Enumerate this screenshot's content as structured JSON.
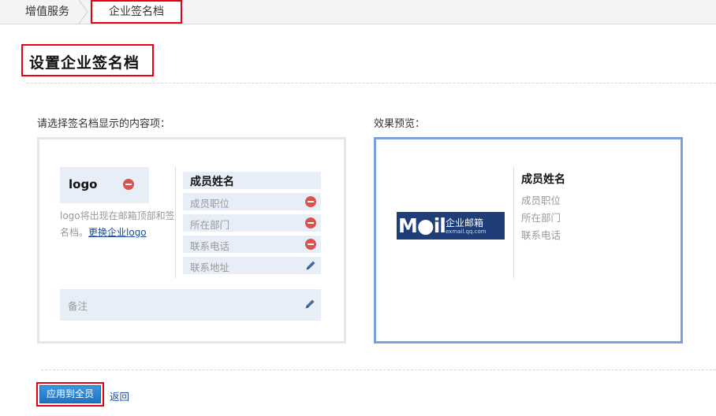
{
  "breadcrumb": {
    "items": [
      "增值服务",
      "企业签名档"
    ]
  },
  "page": {
    "title": "设置企业签名档"
  },
  "editor": {
    "section_label": "请选择签名档显示的内容项：",
    "logo": {
      "label": "logo",
      "note": "logo将出现在邮箱顶部和签名档。",
      "change_link": "更换企业logo"
    },
    "fields": [
      {
        "label": "成员姓名",
        "action": "none"
      },
      {
        "label": "成员职位",
        "action": "remove-icon"
      },
      {
        "label": "所在部门",
        "action": "remove-icon"
      },
      {
        "label": "联系电话",
        "action": "remove-icon"
      },
      {
        "label": "联系地址",
        "action": "pencil-icon"
      }
    ],
    "note_field": {
      "label": "备注",
      "action": "pencil-icon"
    }
  },
  "preview": {
    "section_label": "效果预览：",
    "logo": {
      "brand": "M●il",
      "cn_text": "企业邮箱",
      "url_text": "exmail.qq.com"
    },
    "name": "成员姓名",
    "lines": [
      "成员职位",
      "所在部门",
      "联系电话"
    ]
  },
  "footer": {
    "apply_label": "应用到全员",
    "back_label": "返回"
  },
  "colors": {
    "highlight": "#e60012",
    "field_bg": "#e8eef8",
    "preview_border": "#7aa0dd",
    "button": "#2a84d2",
    "link": "#1a4c96"
  }
}
